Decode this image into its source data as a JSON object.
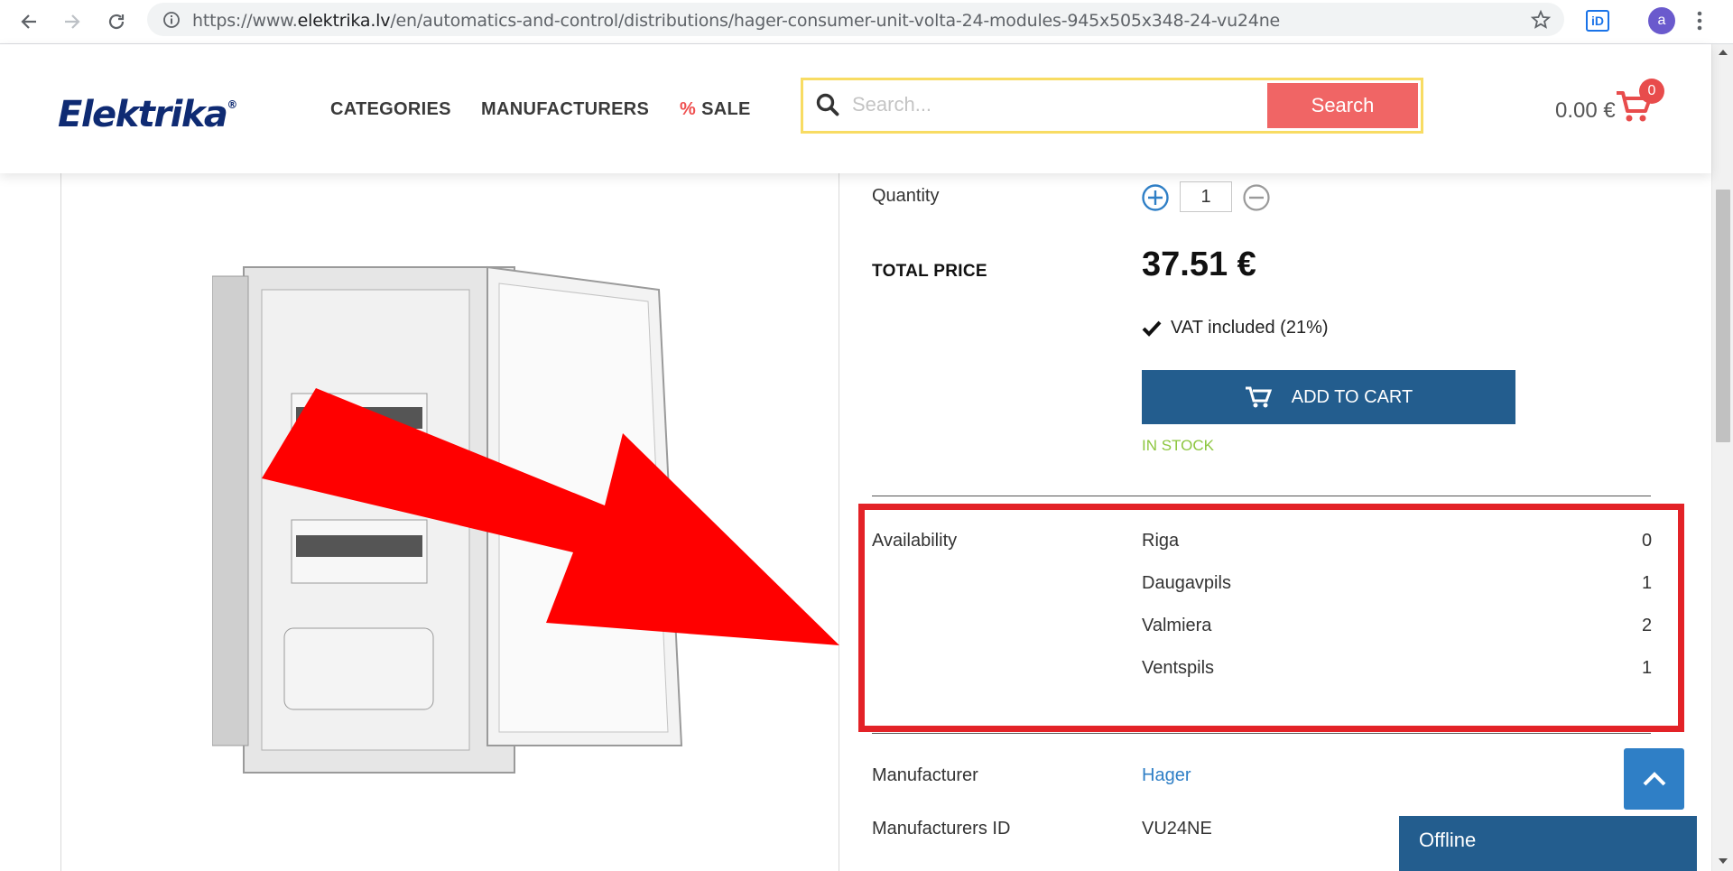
{
  "browser": {
    "url_prefix": "https://www.",
    "url_domain": "elektrika.lv",
    "url_path": "/en/automatics-and-control/distributions/hager-consumer-unit-volta-24-modules-945x505x348-24-vu24ne",
    "profile_initial": "a",
    "extension_label": "iD"
  },
  "header": {
    "logo_text": "Elektrika",
    "logo_mark": "®",
    "menu": {
      "categories": "CATEGORIES",
      "manufacturers": "MANUFACTURERS",
      "sale_symbol": "%",
      "sale": "SALE"
    },
    "search": {
      "placeholder": "Search...",
      "button": "Search"
    },
    "cart": {
      "total": "0.00 €",
      "count": "0"
    }
  },
  "product": {
    "quantity_label": "Quantity",
    "quantity_value": "1",
    "total_price_label": "TOTAL PRICE",
    "total_price": "37.51 €",
    "vat_note": "VAT included (21%)",
    "add_to_cart": "ADD TO CART",
    "stock_status": "IN STOCK",
    "availability_label": "Availability",
    "availability": [
      {
        "store": "Riga",
        "count": "0"
      },
      {
        "store": "Daugavpils",
        "count": "1"
      },
      {
        "store": "Valmiera",
        "count": "2"
      },
      {
        "store": "Ventspils",
        "count": "1"
      }
    ],
    "manufacturer_label": "Manufacturer",
    "manufacturer": "Hager",
    "manufacturer_id_label": "Manufacturers ID",
    "manufacturer_id": "VU24NE"
  },
  "chat": {
    "status": "Offline"
  },
  "colors": {
    "brand_navy": "#0f2b73",
    "search_button": "#f06565",
    "add_to_cart": "#235d8e",
    "in_stock": "#8dc63f",
    "highlight_red": "#e32227",
    "link": "#2f7fc6"
  }
}
